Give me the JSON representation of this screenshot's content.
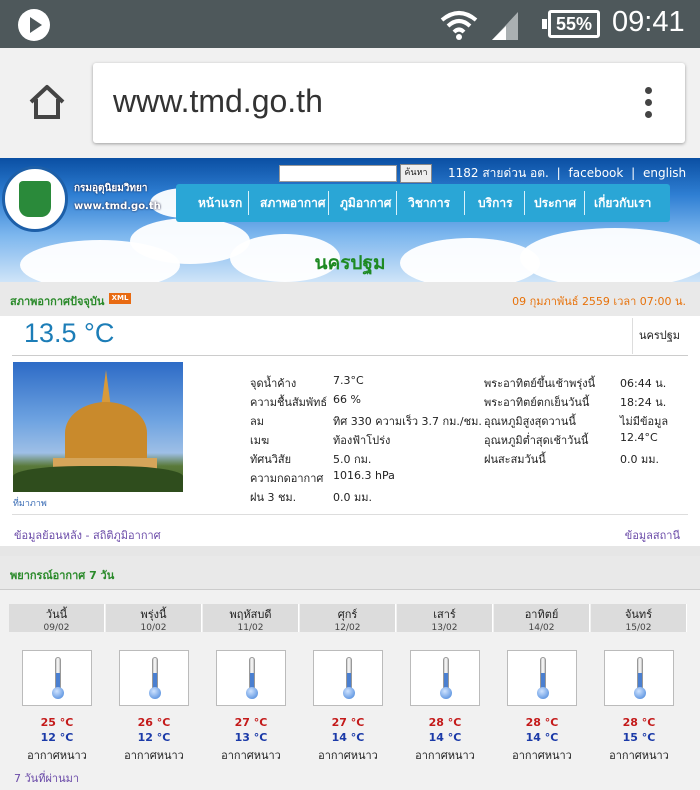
{
  "status_bar": {
    "battery": "55%",
    "time": "09:41"
  },
  "browser": {
    "url": "www.tmd.go.th"
  },
  "site": {
    "logo_text_line1": "กรมอุตุนิยมวิทยา",
    "logo_text_line2": "www.tmd.go.th",
    "search_button": "ค้นหา",
    "hotline": "1182 สายด่วน อต.",
    "facebook": "facebook",
    "english": "english",
    "nav": [
      "หน้าแรก",
      "สภาพอากาศ",
      "ภูมิอากาศ",
      "วิชาการ",
      "บริการ",
      "ประกาศ",
      "เกี่ยวกับเรา"
    ],
    "city": "นครปฐม"
  },
  "current": {
    "title": "สภาพอากาศปัจจุบัน",
    "xml_badge": "XML",
    "datetime": "09 กุมภาพันธ์ 2559 เวลา 07:00 น.",
    "temperature": "13.5 °C",
    "station": "นครปฐม",
    "photo_caption": "ที่มาภาพ",
    "left_obs": [
      {
        "label": "จุดน้ำค้าง",
        "value": "7.3°C"
      },
      {
        "label": "ความชื้นสัมพัทธ์",
        "value": "66 %"
      },
      {
        "label": "ลม",
        "value": "ทิศ 330 ความเร็ว 3.7 กม./ชม."
      },
      {
        "label": "เมฆ",
        "value": "ท้องฟ้าโปร่ง"
      },
      {
        "label": "ทัศนวิสัย",
        "value": "5.0 กม."
      },
      {
        "label": "ความกดอากาศ",
        "value": "1016.3 hPa"
      },
      {
        "label": "ฝน 3 ชม.",
        "value": "0.0 มม."
      }
    ],
    "right_obs": [
      {
        "label": "พระอาทิตย์ขึ้นเช้าพรุ่งนี้",
        "value": "06:44 น."
      },
      {
        "label": "พระอาทิตย์ตกเย็นวันนี้",
        "value": "18:24 น."
      },
      {
        "label": "อุณหภูมิสูงสุดวานนี้",
        "value": "ไม่มีข้อมูล"
      },
      {
        "label": "อุณหภูมิต่ำสุดเช้าวันนี้",
        "value": "12.4°C"
      },
      {
        "label": "ฝนสะสมวันนี้",
        "value": "0.0 มม."
      }
    ],
    "history_link": "ข้อมูลย้อนหลัง - สถิติภูมิอากาศ",
    "station_link": "ข้อมูลสถานี"
  },
  "forecast": {
    "title": "พยากรณ์อากาศ 7 วัน",
    "days": [
      {
        "day": "วันนี้",
        "date": "09/02",
        "max": "25 °C",
        "min": "12 °C",
        "desc": "อากาศหนาว"
      },
      {
        "day": "พรุ่งนี้",
        "date": "10/02",
        "max": "26 °C",
        "min": "12 °C",
        "desc": "อากาศหนาว"
      },
      {
        "day": "พฤหัสบดี",
        "date": "11/02",
        "max": "27 °C",
        "min": "13 °C",
        "desc": "อากาศหนาว"
      },
      {
        "day": "ศุกร์",
        "date": "12/02",
        "max": "27 °C",
        "min": "14 °C",
        "desc": "อากาศหนาว"
      },
      {
        "day": "เสาร์",
        "date": "13/02",
        "max": "28 °C",
        "min": "14 °C",
        "desc": "อากาศหนาว"
      },
      {
        "day": "อาทิตย์",
        "date": "14/02",
        "max": "28 °C",
        "min": "14 °C",
        "desc": "อากาศหนาว"
      },
      {
        "day": "จันทร์",
        "date": "15/02",
        "max": "28 °C",
        "min": "15 °C",
        "desc": "อากาศหนาว"
      }
    ],
    "past_link": "7 วันที่ผ่านมา"
  }
}
